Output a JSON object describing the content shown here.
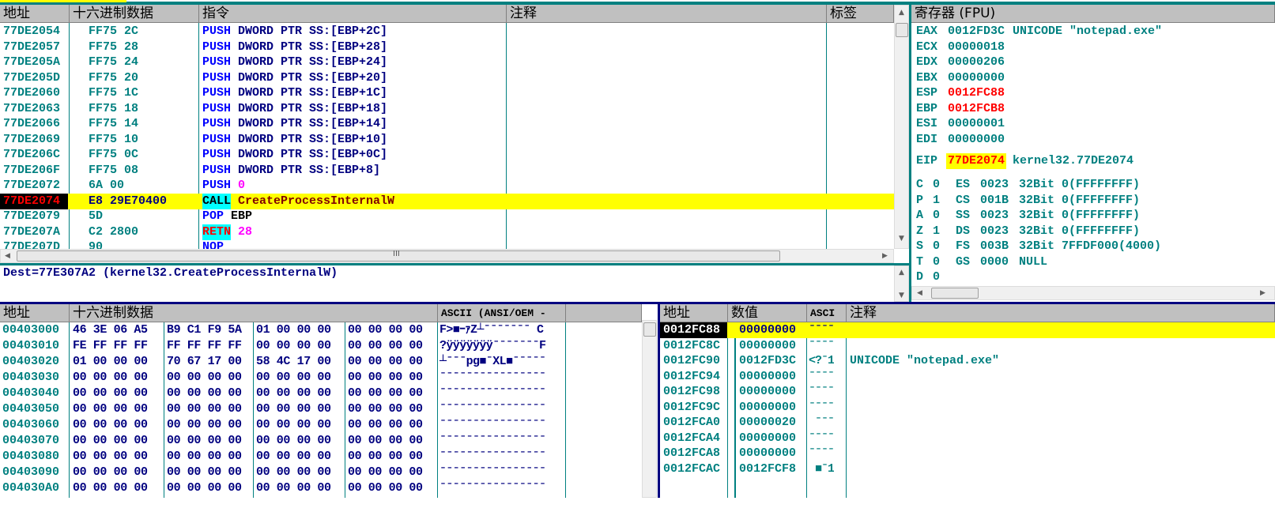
{
  "colors": {
    "accent": "#008080",
    "highlight": "#ffff00",
    "eip_bg": "#000000",
    "mnemonic": "#0000ff",
    "operand": "#000080",
    "constant": "#ff00ff",
    "changed_reg": "#ff0000"
  },
  "disasm": {
    "headers": [
      "地址",
      "十六进制数据",
      "指令",
      "注释",
      "标签"
    ],
    "rows": [
      {
        "addr": "77DE2054",
        "hex": "FF75 2C",
        "mn": "PUSH",
        "op": "DWORD PTR SS:[EBP+2C]"
      },
      {
        "addr": "77DE2057",
        "hex": "FF75 28",
        "mn": "PUSH",
        "op": "DWORD PTR SS:[EBP+28]"
      },
      {
        "addr": "77DE205A",
        "hex": "FF75 24",
        "mn": "PUSH",
        "op": "DWORD PTR SS:[EBP+24]"
      },
      {
        "addr": "77DE205D",
        "hex": "FF75 20",
        "mn": "PUSH",
        "op": "DWORD PTR SS:[EBP+20]"
      },
      {
        "addr": "77DE2060",
        "hex": "FF75 1C",
        "mn": "PUSH",
        "op": "DWORD PTR SS:[EBP+1C]"
      },
      {
        "addr": "77DE2063",
        "hex": "FF75 18",
        "mn": "PUSH",
        "op": "DWORD PTR SS:[EBP+18]"
      },
      {
        "addr": "77DE2066",
        "hex": "FF75 14",
        "mn": "PUSH",
        "op": "DWORD PTR SS:[EBP+14]"
      },
      {
        "addr": "77DE2069",
        "hex": "FF75 10",
        "mn": "PUSH",
        "op": "DWORD PTR SS:[EBP+10]"
      },
      {
        "addr": "77DE206C",
        "hex": "FF75 0C",
        "mn": "PUSH",
        "op": "DWORD PTR SS:[EBP+0C]"
      },
      {
        "addr": "77DE206F",
        "hex": "FF75 08",
        "mn": "PUSH",
        "op": "DWORD PTR SS:[EBP+8]"
      },
      {
        "addr": "77DE2072",
        "hex": "6A 00",
        "mn": "PUSH",
        "op": "0",
        "kind": "const"
      },
      {
        "addr": "77DE2074",
        "hex": "E8 29E70400",
        "mn": "CALL",
        "op": "CreateProcessInternalW",
        "kind": "call",
        "current": true
      },
      {
        "addr": "77DE2079",
        "hex": "5D",
        "mn": "POP",
        "op": "EBP",
        "kind": "pop"
      },
      {
        "addr": "77DE207A",
        "hex": "C2 2800",
        "mn": "RETN",
        "op": "28",
        "kind": "ret"
      },
      {
        "addr": "77DE207D",
        "hex": "90",
        "mn": "NOP",
        "op": ""
      }
    ]
  },
  "info": {
    "text": "Dest=77E307A2 (kernel32.CreateProcessInternalW)"
  },
  "registers": {
    "title": "寄存器 (FPU)",
    "gpr": [
      {
        "name": "EAX",
        "value": "0012FD3C",
        "comment": "UNICODE \"notepad.exe\""
      },
      {
        "name": "ECX",
        "value": "00000018",
        "comment": ""
      },
      {
        "name": "EDX",
        "value": "00000206",
        "comment": ""
      },
      {
        "name": "EBX",
        "value": "00000000",
        "comment": ""
      },
      {
        "name": "ESP",
        "value": "0012FC88",
        "comment": "",
        "changed": true
      },
      {
        "name": "EBP",
        "value": "0012FCB8",
        "comment": "",
        "changed": true
      },
      {
        "name": "ESI",
        "value": "00000001",
        "comment": ""
      },
      {
        "name": "EDI",
        "value": "00000000",
        "comment": ""
      }
    ],
    "eip": {
      "name": "EIP",
      "value": "77DE2074",
      "comment": "kernel32.77DE2074"
    },
    "flags": [
      {
        "flag": "C",
        "val": "0",
        "seg": "ES",
        "sel": "0023",
        "desc": "32Bit 0(FFFFFFFF)"
      },
      {
        "flag": "P",
        "val": "1",
        "seg": "CS",
        "sel": "001B",
        "desc": "32Bit 0(FFFFFFFF)"
      },
      {
        "flag": "A",
        "val": "0",
        "seg": "SS",
        "sel": "0023",
        "desc": "32Bit 0(FFFFFFFF)"
      },
      {
        "flag": "Z",
        "val": "1",
        "seg": "DS",
        "sel": "0023",
        "desc": "32Bit 0(FFFFFFFF)"
      },
      {
        "flag": "S",
        "val": "0",
        "seg": "FS",
        "sel": "003B",
        "desc": "32Bit 7FFDF000(4000)"
      },
      {
        "flag": "T",
        "val": "0",
        "seg": "GS",
        "sel": "0000",
        "desc": "NULL"
      },
      {
        "flag": "D",
        "val": "0",
        "seg": "",
        "sel": "",
        "desc": ""
      }
    ]
  },
  "dump": {
    "headers": [
      "地址",
      "十六进制数据",
      "ASCII (ANSI/OEM -"
    ],
    "rows": [
      {
        "addr": "00403000",
        "hex": [
          "46 3E 06 A5",
          "B9 C1 F9 5A",
          "01 00 00 00",
          "00 00 00 00"
        ],
        "ascii": "F>■ｰｧZ┴ˉˉˉˉˉˉˉ C"
      },
      {
        "addr": "00403010",
        "hex": [
          "FE FF FF FF",
          "FF FF FF FF",
          "00 00 00 00",
          "00 00 00 00"
        ],
        "ascii": "?ÿÿÿÿÿÿÿˉˉˉˉˉˉˉF"
      },
      {
        "addr": "00403020",
        "hex": [
          "01 00 00 00",
          "70 67 17 00",
          "58 4C 17 00",
          "00 00 00 00"
        ],
        "ascii": "┴ˉˉˉpg■ˉXL■ˉˉˉˉˉ"
      },
      {
        "addr": "00403030",
        "hex": [
          "00 00 00 00",
          "00 00 00 00",
          "00 00 00 00",
          "00 00 00 00"
        ],
        "ascii": "ˉˉˉˉˉˉˉˉˉˉˉˉˉˉˉˉ"
      },
      {
        "addr": "00403040",
        "hex": [
          "00 00 00 00",
          "00 00 00 00",
          "00 00 00 00",
          "00 00 00 00"
        ],
        "ascii": "ˉˉˉˉˉˉˉˉˉˉˉˉˉˉˉˉ"
      },
      {
        "addr": "00403050",
        "hex": [
          "00 00 00 00",
          "00 00 00 00",
          "00 00 00 00",
          "00 00 00 00"
        ],
        "ascii": "ˉˉˉˉˉˉˉˉˉˉˉˉˉˉˉˉ"
      },
      {
        "addr": "00403060",
        "hex": [
          "00 00 00 00",
          "00 00 00 00",
          "00 00 00 00",
          "00 00 00 00"
        ],
        "ascii": "ˉˉˉˉˉˉˉˉˉˉˉˉˉˉˉˉ"
      },
      {
        "addr": "00403070",
        "hex": [
          "00 00 00 00",
          "00 00 00 00",
          "00 00 00 00",
          "00 00 00 00"
        ],
        "ascii": "ˉˉˉˉˉˉˉˉˉˉˉˉˉˉˉˉ"
      },
      {
        "addr": "00403080",
        "hex": [
          "00 00 00 00",
          "00 00 00 00",
          "00 00 00 00",
          "00 00 00 00"
        ],
        "ascii": "ˉˉˉˉˉˉˉˉˉˉˉˉˉˉˉˉ"
      },
      {
        "addr": "00403090",
        "hex": [
          "00 00 00 00",
          "00 00 00 00",
          "00 00 00 00",
          "00 00 00 00"
        ],
        "ascii": "ˉˉˉˉˉˉˉˉˉˉˉˉˉˉˉˉ"
      },
      {
        "addr": "004030A0",
        "hex": [
          "00 00 00 00",
          "00 00 00 00",
          "00 00 00 00",
          "00 00 00 00"
        ],
        "ascii": "ˉˉˉˉˉˉˉˉˉˉˉˉˉˉˉˉ"
      }
    ]
  },
  "stack": {
    "headers": [
      "地址",
      "数值",
      "ASCI",
      "注释"
    ],
    "rows": [
      {
        "addr": "0012FC88",
        "value": "00000000",
        "ascii": "ˉˉˉˉ",
        "comment": "",
        "top": true
      },
      {
        "addr": "0012FC8C",
        "value": "00000000",
        "ascii": "ˉˉˉˉ",
        "comment": ""
      },
      {
        "addr": "0012FC90",
        "value": "0012FD3C",
        "ascii": "<?ˉ1",
        "comment": "UNICODE \"notepad.exe\""
      },
      {
        "addr": "0012FC94",
        "value": "00000000",
        "ascii": "ˉˉˉˉ",
        "comment": ""
      },
      {
        "addr": "0012FC98",
        "value": "00000000",
        "ascii": "ˉˉˉˉ",
        "comment": ""
      },
      {
        "addr": "0012FC9C",
        "value": "00000000",
        "ascii": "ˉˉˉˉ",
        "comment": ""
      },
      {
        "addr": "0012FCA0",
        "value": "00000020",
        "ascii": " ˉˉˉ",
        "comment": ""
      },
      {
        "addr": "0012FCA4",
        "value": "00000000",
        "ascii": "ˉˉˉˉ",
        "comment": ""
      },
      {
        "addr": "0012FCA8",
        "value": "00000000",
        "ascii": "ˉˉˉˉ",
        "comment": ""
      },
      {
        "addr": "0012FCAC",
        "value": "0012FCF8",
        "ascii": " ■ˉ1",
        "comment": ""
      }
    ]
  },
  "scroll_grip": "III"
}
